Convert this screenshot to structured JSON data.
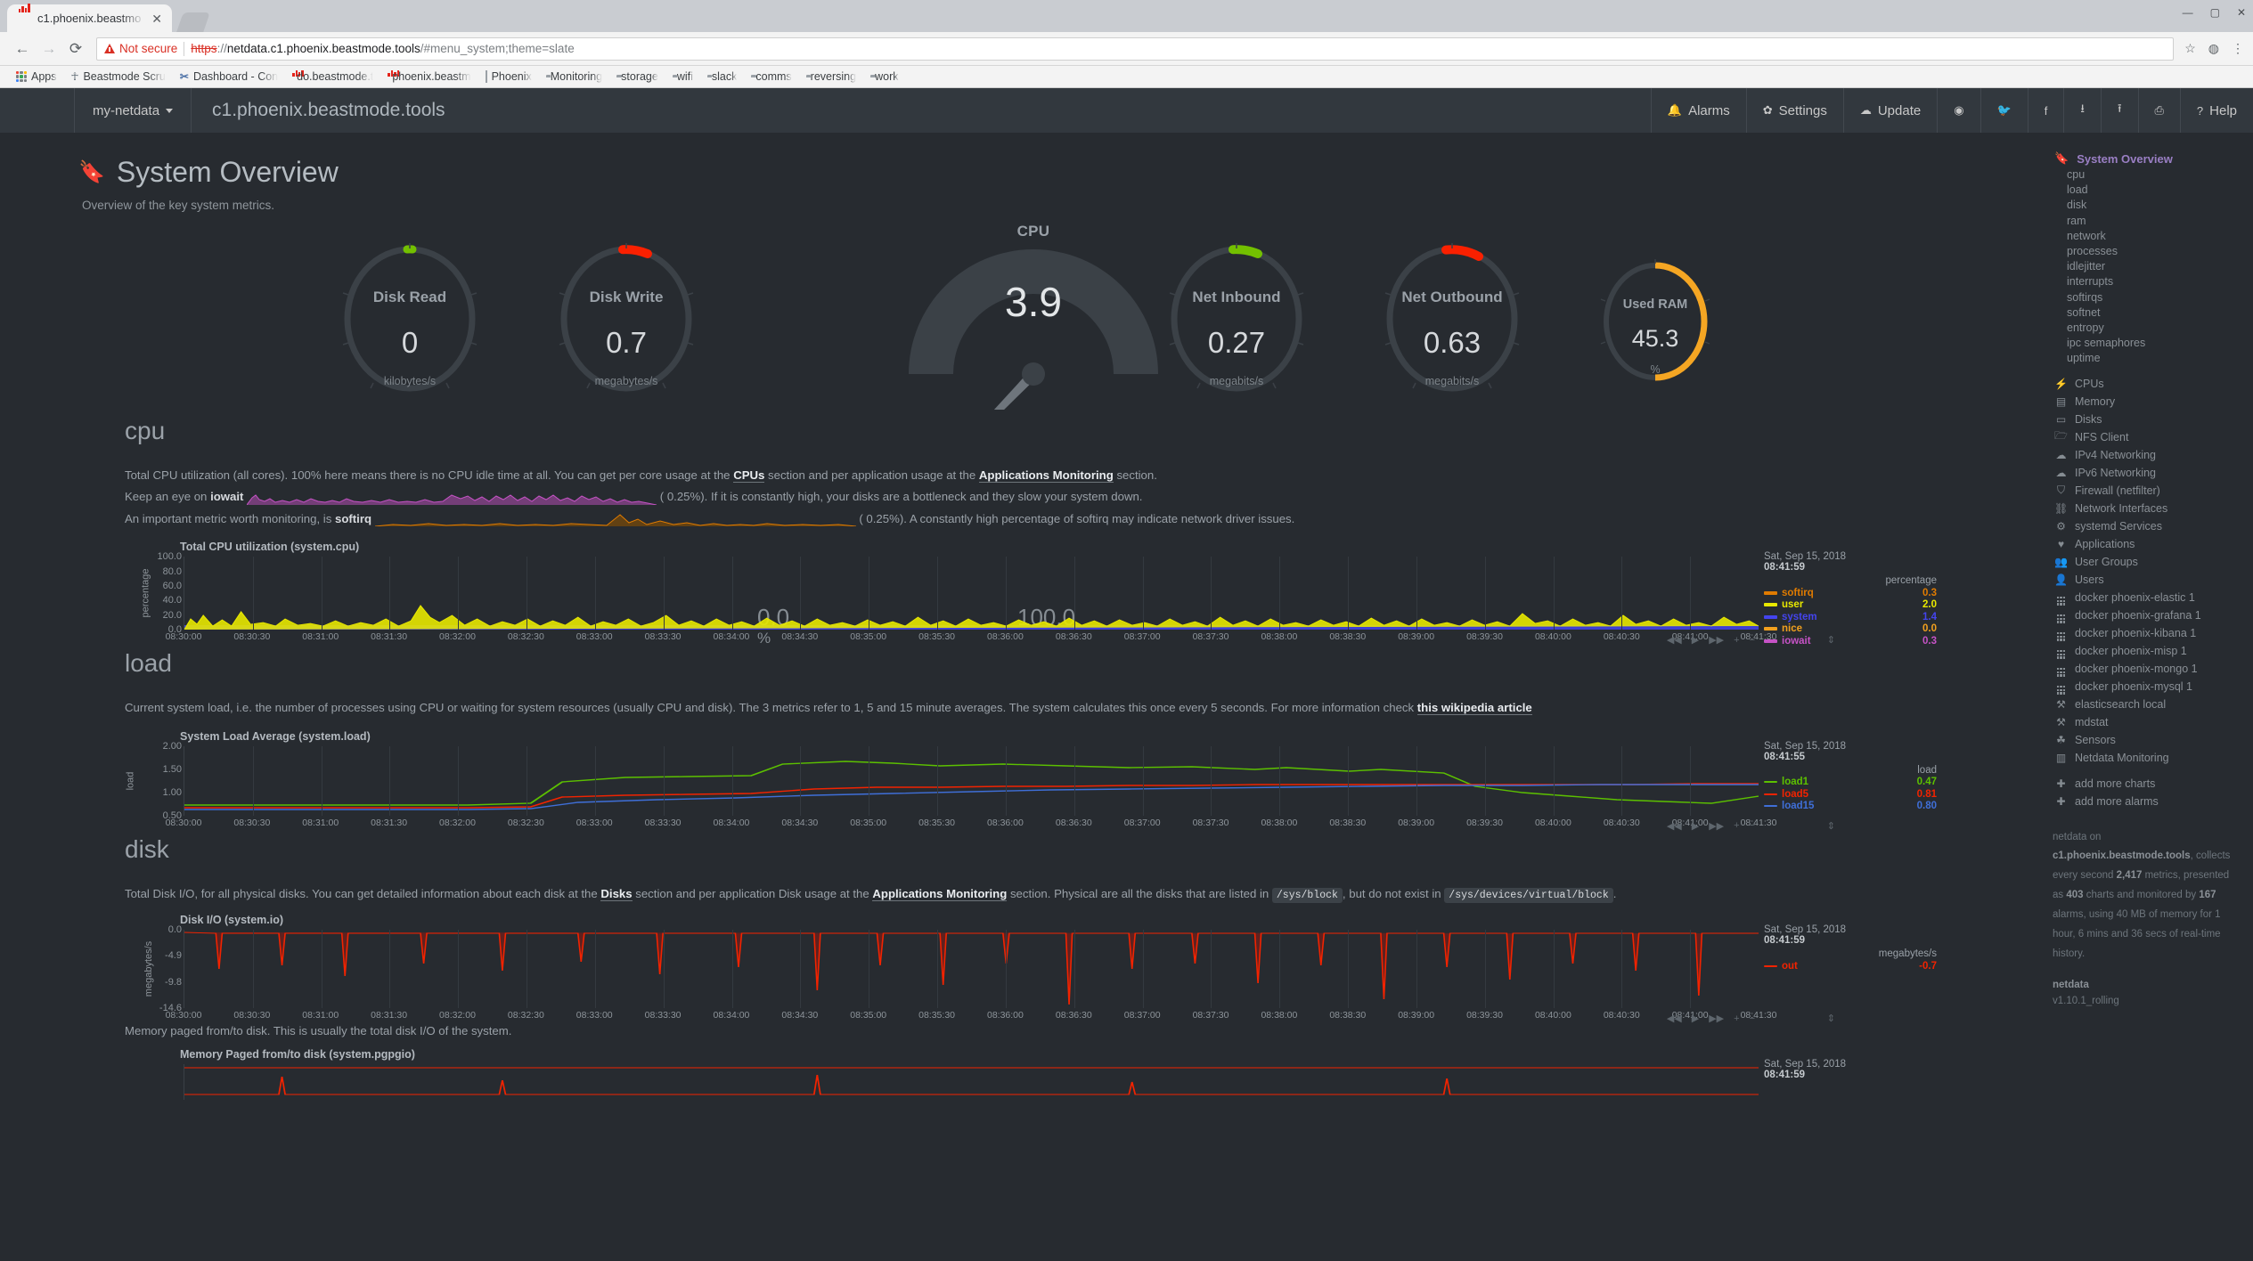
{
  "browser": {
    "tab": {
      "title": "c1.phoenix.beastmo",
      "close": "✕",
      "favicon": "netdata-icon"
    },
    "nav": {
      "back": "←",
      "forward": "→",
      "reload": "⟳"
    },
    "security_label": "Not secure",
    "url": {
      "scheme": "https",
      "sep": "://",
      "host": "netdata.c1.phoenix.beastmode.tools",
      "path": "/#menu_system;theme=slate"
    },
    "omnibar_icons": [
      "star-icon",
      "profile-icon",
      "menu-icon"
    ],
    "window_buttons": [
      "minimize",
      "maximize",
      "close"
    ],
    "bookmarks": [
      {
        "label": "Apps",
        "icon": "apps-grid-icon"
      },
      {
        "label": "Beastmode Scru",
        "icon": "bug-icon"
      },
      {
        "label": "Dashboard - Con",
        "icon": "x-icon"
      },
      {
        "label": "do.beastmode.t",
        "icon": "netdata-icon"
      },
      {
        "label": "phoenix.beastm",
        "icon": "netdata-icon"
      },
      {
        "label": "Phoenix",
        "icon": "doc-icon"
      },
      {
        "label": "Monitoring",
        "icon": "folder-icon"
      },
      {
        "label": "storage",
        "icon": "folder-icon"
      },
      {
        "label": "wifi",
        "icon": "folder-icon"
      },
      {
        "label": "slack",
        "icon": "folder-icon"
      },
      {
        "label": "comms",
        "icon": "folder-icon"
      },
      {
        "label": "reversing",
        "icon": "folder-icon"
      },
      {
        "label": "work",
        "icon": "folder-icon"
      }
    ]
  },
  "navbar": {
    "my_netdata": "my-netdata",
    "hostname": "c1.phoenix.beastmode.tools",
    "right": [
      {
        "label": "Alarms",
        "icon": "bell-icon"
      },
      {
        "label": "Settings",
        "icon": "gear-icon"
      },
      {
        "label": "Update",
        "icon": "cloud-download-icon"
      },
      {
        "label": "",
        "icon": "github-icon"
      },
      {
        "label": "",
        "icon": "twitter-icon"
      },
      {
        "label": "",
        "icon": "facebook-icon"
      },
      {
        "label": "",
        "icon": "import-icon"
      },
      {
        "label": "",
        "icon": "export-icon"
      },
      {
        "label": "",
        "icon": "print-icon"
      },
      {
        "label": "Help",
        "icon": "help-icon"
      }
    ]
  },
  "page": {
    "title": "System Overview",
    "subtitle": "Overview of the key system metrics."
  },
  "gauges": {
    "disk_read": {
      "title": "Disk Read",
      "value": "0",
      "unit": "kilobytes/s",
      "arc_color": "#73c000",
      "arc_pct": 2
    },
    "disk_write": {
      "title": "Disk Write",
      "value": "0.7",
      "unit": "megabytes/s",
      "arc_color": "#fa2000",
      "arc_pct": 6
    },
    "net_inbound": {
      "title": "Net Inbound",
      "value": "0.27",
      "unit": "megabits/s",
      "arc_color": "#73c000",
      "arc_pct": 6
    },
    "net_outbound": {
      "title": "Net Outbound",
      "value": "0.63",
      "unit": "megabits/s",
      "arc_color": "#fa2000",
      "arc_pct": 9
    },
    "used_ram": {
      "title": "Used RAM",
      "value": "45.3",
      "unit": "%",
      "arc_color": "#f5a623",
      "arc_pct": 45
    },
    "cpu": {
      "title": "CPU",
      "value": "3.9",
      "min": "0.0",
      "max": "100.0",
      "unit": "%",
      "needle_color": "#19b5ad"
    }
  },
  "sections": {
    "cpu": {
      "title": "cpu",
      "desc_1_a": "Total CPU utilization (all cores). 100% here means there is no CPU idle time at all. You can get per core usage at the ",
      "desc_1_link1": "CPUs",
      "desc_1_b": " section and per application usage at the ",
      "desc_1_link2": "Applications Monitoring",
      "desc_1_c": " section.",
      "desc_2_a": "Keep an eye on ",
      "desc_2_bold": "iowait",
      "desc_2_val": "(    0.25%).",
      "desc_2_b": " If it is constantly high, your disks are a bottleneck and they slow your system down.",
      "desc_3_a": "An important metric worth monitoring, is ",
      "desc_3_bold": "softirq",
      "desc_3_val": "(    0.25%).",
      "desc_3_b": " A constantly high percentage of softirq may indicate network driver issues.",
      "chart_title": "Total CPU utilization (system.cpu)"
    },
    "load": {
      "title": "load",
      "desc_a": "Current system load, i.e. the number of processes using CPU or waiting for system resources (usually CPU and disk). The 3 metrics refer to 1, 5 and 15 minute averages. The system calculates this once every 5 seconds. For more information check ",
      "desc_link": "this wikipedia article",
      "chart_title": "System Load Average (system.load)"
    },
    "disk": {
      "title": "disk",
      "desc_a": "Total Disk I/O, for all physical disks. You can get detailed information about each disk at the ",
      "desc_link1": "Disks",
      "desc_b": " section and per application Disk usage at the ",
      "desc_link2": "Applications Monitoring",
      "desc_c": " section. Physical are all the disks that are listed in ",
      "desc_code1": "/sys/block",
      "desc_d": ", but do not exist in ",
      "desc_code2": "/sys/devices/virtual/block",
      "desc_e": ".",
      "chart_title": "Disk I/O (system.io)",
      "desc2": "Memory paged from/to disk. This is usually the total disk I/O of the system.",
      "chart_title2": "Memory Paged from/to disk (system.pgpgio)"
    }
  },
  "chart_data": [
    {
      "type": "area",
      "id": "system.cpu",
      "title": "Total CPU utilization (system.cpu)",
      "ylabel": "percentage",
      "ylim": [
        0,
        100
      ],
      "yticks": [
        "0.0",
        "20.0",
        "40.0",
        "60.0",
        "80.0",
        "100.0"
      ],
      "xticks": [
        "08:30:00",
        "08:30:30",
        "08:31:00",
        "08:31:30",
        "08:32:00",
        "08:32:30",
        "08:33:00",
        "08:33:30",
        "08:34:00",
        "08:34:30",
        "08:35:00",
        "08:35:30",
        "08:36:00",
        "08:36:30",
        "08:37:00",
        "08:37:30",
        "08:38:00",
        "08:38:30",
        "08:39:00",
        "08:39:30",
        "08:40:00",
        "08:40:30",
        "08:41:00",
        "08:41:30"
      ],
      "grid": true,
      "legend_position": "right",
      "legend_date": "Sat, Sep 15, 2018",
      "legend_time": "08:41:59",
      "legend_unit": "percentage",
      "series": [
        {
          "name": "softirq",
          "value": "0.3",
          "color": "#e07b00"
        },
        {
          "name": "user",
          "value": "2.0",
          "color": "#e8e800"
        },
        {
          "name": "system",
          "value": "1.4",
          "color": "#4444ee"
        },
        {
          "name": "nice",
          "value": "0.0",
          "color": "#f2a01e"
        },
        {
          "name": "iowait",
          "value": "0.3",
          "color": "#c653c6"
        }
      ]
    },
    {
      "type": "line",
      "id": "system.load",
      "title": "System Load Average (system.load)",
      "ylabel": "load",
      "ylim": [
        0.5,
        2.0
      ],
      "yticks": [
        "0.50",
        "1.00",
        "1.50",
        "2.00"
      ],
      "xticks": [
        "08:30:00",
        "08:30:30",
        "08:31:00",
        "08:31:30",
        "08:32:00",
        "08:32:30",
        "08:33:00",
        "08:33:30",
        "08:34:00",
        "08:34:30",
        "08:35:00",
        "08:35:30",
        "08:36:00",
        "08:36:30",
        "08:37:00",
        "08:37:30",
        "08:38:00",
        "08:38:30",
        "08:39:00",
        "08:39:30",
        "08:40:00",
        "08:40:30",
        "08:41:00",
        "08:41:30"
      ],
      "grid": true,
      "legend_position": "right",
      "legend_date": "Sat, Sep 15, 2018",
      "legend_time": "08:41:55",
      "legend_unit": "load",
      "series": [
        {
          "name": "load1",
          "value": "0.47",
          "color": "#5cc000"
        },
        {
          "name": "load5",
          "value": "0.81",
          "color": "#f22300"
        },
        {
          "name": "load15",
          "value": "0.80",
          "color": "#3f6fd8"
        }
      ]
    },
    {
      "type": "area",
      "id": "system.io",
      "title": "Disk I/O (system.io)",
      "ylabel": "megabytes/s",
      "ylim": [
        -14.6,
        0.0
      ],
      "yticks": [
        "0.0",
        "-4.9",
        "-9.8",
        "-14.6"
      ],
      "xticks": [
        "08:30:00",
        "08:30:30",
        "08:31:00",
        "08:31:30",
        "08:32:00",
        "08:32:30",
        "08:33:00",
        "08:33:30",
        "08:34:00",
        "08:34:30",
        "08:35:00",
        "08:35:30",
        "08:36:00",
        "08:36:30",
        "08:37:00",
        "08:37:30",
        "08:38:00",
        "08:38:30",
        "08:39:00",
        "08:39:30",
        "08:40:00",
        "08:40:30",
        "08:41:00",
        "08:41:30"
      ],
      "grid": true,
      "legend_position": "right",
      "legend_date": "Sat, Sep 15, 2018",
      "legend_time": "08:41:59",
      "legend_unit": "megabytes/s",
      "series": [
        {
          "name": "out",
          "value": "-0.7",
          "color": "#f22300"
        }
      ]
    },
    {
      "type": "area",
      "id": "system.pgpgio",
      "title": "Memory Paged from/to disk (system.pgpgio)",
      "legend_date": "Sat, Sep 15, 2018",
      "legend_time": "08:41:59",
      "series": []
    }
  ],
  "chart_controls": {
    "back": "◀◀",
    "play": "▶",
    "forward": "▶▶",
    "zoom_in": "+",
    "zoom_out": "−",
    "resize": "⇕"
  },
  "sidebar": {
    "active": {
      "label": "System Overview",
      "icon": "bookmark-icon"
    },
    "sub_items": [
      "cpu",
      "load",
      "disk",
      "ram",
      "network",
      "processes",
      "idlejitter",
      "interrupts",
      "softirqs",
      "softnet",
      "entropy",
      "ipc semaphores",
      "uptime"
    ],
    "items": [
      {
        "label": "CPUs",
        "icon": "bolt-icon"
      },
      {
        "label": "Memory",
        "icon": "memory-icon"
      },
      {
        "label": "Disks",
        "icon": "hdd-icon"
      },
      {
        "label": "NFS Client",
        "icon": "folder-open-icon"
      },
      {
        "label": "IPv4 Networking",
        "icon": "cloud-icon"
      },
      {
        "label": "IPv6 Networking",
        "icon": "cloud-icon"
      },
      {
        "label": "Firewall (netfilter)",
        "icon": "shield-icon"
      },
      {
        "label": "Network Interfaces",
        "icon": "sitemap-icon"
      },
      {
        "label": "systemd Services",
        "icon": "cogs-icon"
      },
      {
        "label": "Applications",
        "icon": "heartbeat-icon"
      },
      {
        "label": "User Groups",
        "icon": "users-icon"
      },
      {
        "label": "Users",
        "icon": "user-icon"
      },
      {
        "label": "docker phoenix-elastic 1",
        "icon": "grid-icon"
      },
      {
        "label": "docker phoenix-grafana 1",
        "icon": "grid-icon"
      },
      {
        "label": "docker phoenix-kibana 1",
        "icon": "grid-icon"
      },
      {
        "label": "docker phoenix-misp 1",
        "icon": "grid-icon"
      },
      {
        "label": "docker phoenix-mongo 1",
        "icon": "grid-icon"
      },
      {
        "label": "docker phoenix-mysql 1",
        "icon": "grid-icon"
      },
      {
        "label": "elasticsearch local",
        "icon": "puzzle-icon"
      },
      {
        "label": "mdstat",
        "icon": "puzzle-icon"
      },
      {
        "label": "Sensors",
        "icon": "leaf-icon"
      },
      {
        "label": "Netdata Monitoring",
        "icon": "bar-chart-icon"
      }
    ],
    "actions": [
      {
        "label": "add more charts",
        "icon": "plus-icon"
      },
      {
        "label": "add more alarms",
        "icon": "plus-icon"
      }
    ],
    "footer": {
      "l1": "netdata on",
      "host": "c1.phoenix.beastmode.tools",
      "l2": ", collects every second ",
      "metrics": "2,417",
      "l3": " metrics, presented as ",
      "charts": "403",
      "l4": " charts and monitored by ",
      "alarms": "167",
      "l5": " alarms, using 40 MB of memory for 1 hour, 6 mins and 36 secs of real-time history.",
      "product": "netdata",
      "version": "v1.10.1_rolling"
    }
  }
}
